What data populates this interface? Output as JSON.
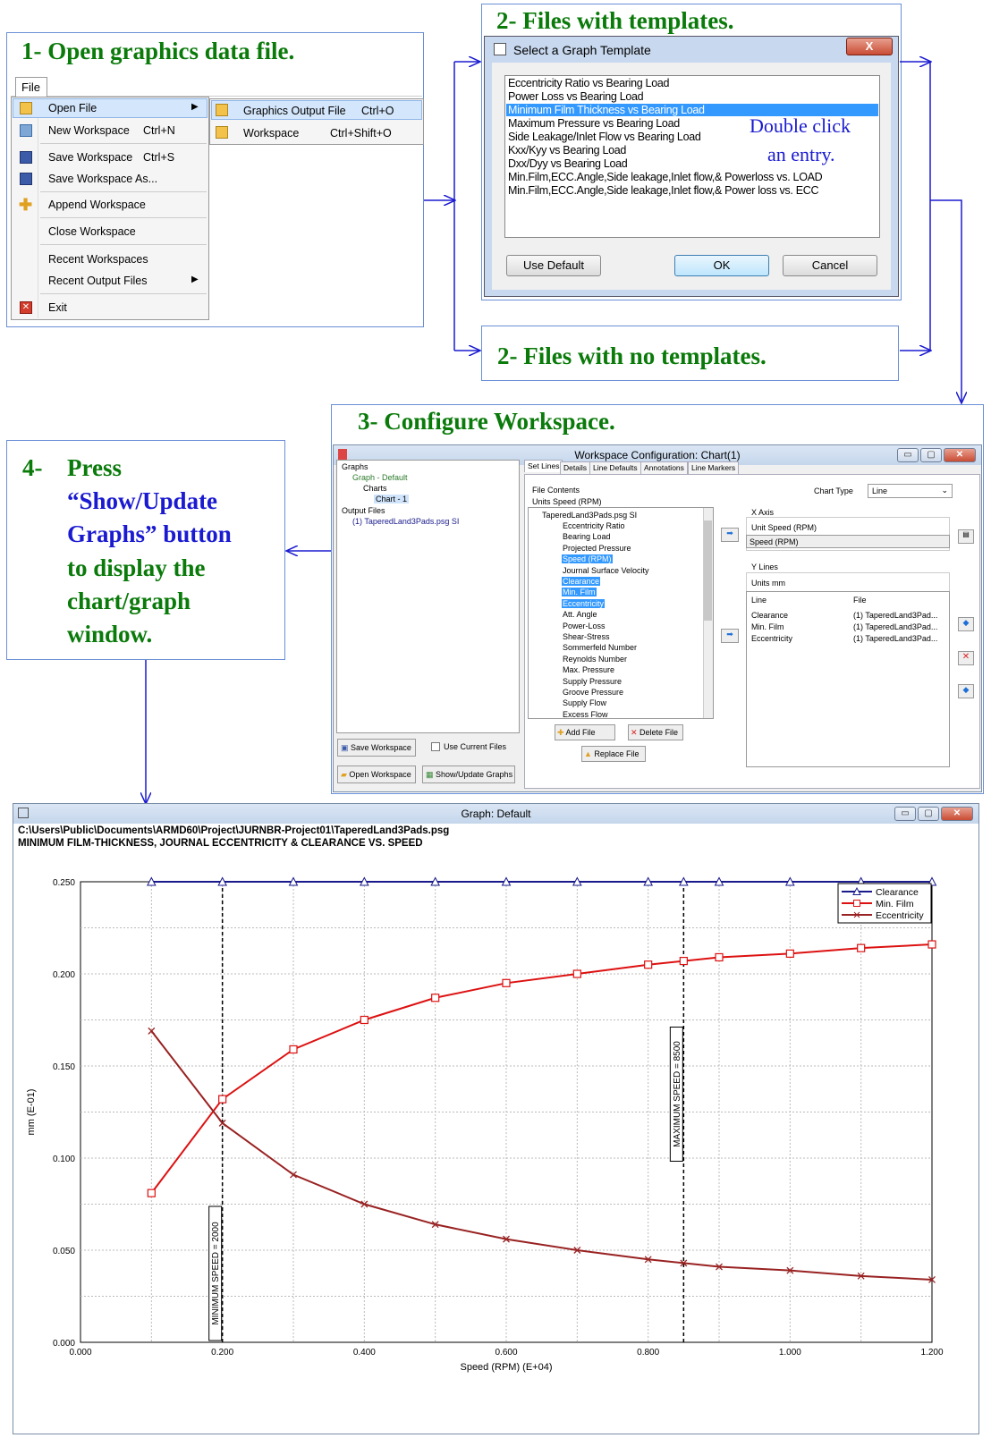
{
  "step1": {
    "title": "1-  Open graphics data file.",
    "menu_bar": "File",
    "items": [
      "Open File",
      "New Workspace",
      "Save Workspace",
      "Save Workspace As...",
      "Append Workspace",
      "Close Workspace",
      "Recent Workspaces",
      "Recent Output Files",
      "Exit"
    ],
    "shortcuts": {
      "new": "Ctrl+N",
      "save": "Ctrl+S"
    },
    "submenu": [
      {
        "label": "Graphics Output File",
        "shortcut": "Ctrl+O"
      },
      {
        "label": "Workspace",
        "shortcut": "Ctrl+Shift+O"
      }
    ]
  },
  "step2a": {
    "title": "2-  Files with templates.",
    "dialog_title": "Select a Graph Template",
    "templates": [
      "Eccentricity Ratio vs Bearing Load",
      "Power Loss vs Bearing Load",
      "Minimum Film Thickness vs Bearing Load",
      "Maximum Pressure vs Bearing Load",
      "Side Leakage/Inlet Flow vs Bearing Load",
      "Kxx/Kyy vs Bearing Load",
      "Dxx/Dyy vs Bearing Load",
      "Min.Film,ECC.Angle,Side leakage,Inlet flow,& Powerloss vs. LOAD",
      "Min.Film,ECC.Angle,Side leakage,Inlet flow,& Power loss vs. ECC"
    ],
    "hint_line1": "Double click",
    "hint_line2": "an  entry.",
    "btn_default": "Use Default",
    "btn_ok": "OK",
    "btn_cancel": "Cancel"
  },
  "step2b": {
    "title": "2-  Files with no templates."
  },
  "step3": {
    "title": "3-  Configure Workspace.",
    "window_title": "Workspace Configuration: Chart(1)",
    "tree": [
      "Graphs",
      "Graph - Default",
      "Charts",
      "Chart - 1",
      "Output Files",
      "(1) TaperedLand3Pads.psg SI"
    ],
    "tabs": [
      "Set Lines",
      "Details",
      "Line Defaults",
      "Annotations",
      "Line Markers"
    ],
    "file_contents_label": "File Contents",
    "units_label": "Units   Speed (RPM)",
    "file_root": "TaperedLand3Pads.psg SI",
    "file_items": [
      "Eccentricity Ratio",
      "Bearing Load",
      "Projected Pressure",
      "Speed (RPM)",
      "Journal Surface Velocity",
      "Clearance",
      "Min. Film",
      "Eccentricity",
      "Att. Angle",
      "Power-Loss",
      "Shear-Stress",
      "Sommerfeld Number",
      "Reynolds Number",
      "Max. Pressure",
      "Supply Pressure",
      "Groove Pressure",
      "Supply Flow",
      "Excess Flow"
    ],
    "chart_type_label": "Chart Type",
    "chart_type_value": "Line",
    "x_axis_label": "X Axis",
    "x_unit": "Unit   Speed (RPM)",
    "x_value": "Speed (RPM)",
    "y_lines_label": "Y Lines",
    "y_units": "Units  mm",
    "y_headers": [
      "Line",
      "File"
    ],
    "y_rows": [
      [
        "Clearance",
        "(1) TaperedLand3Pad..."
      ],
      [
        "Min. Film",
        "(1) TaperedLand3Pad..."
      ],
      [
        "Eccentricity",
        "(1) TaperedLand3Pad..."
      ]
    ],
    "btn_add_file": "Add File",
    "btn_delete_file": "Delete File",
    "btn_replace_file": "Replace File",
    "btn_save_ws": "Save Workspace",
    "chk_use_current": "Use Current Files",
    "btn_open_ws": "Open Workspace",
    "btn_show_update": "Show/Update Graphs"
  },
  "step4": {
    "num": "4-",
    "line1": "Press",
    "line2": "“Show/Update",
    "line3": "Graphs” button",
    "line4": "to display the",
    "line5": "chart/graph",
    "line6": "window."
  },
  "graph_window": {
    "title": "Graph: Default",
    "path": "C:\\Users\\Public\\Documents\\ARMD60\\Project\\JURNBR-Project01\\TaperedLand3Pads.psg",
    "heading": "MINIMUM FILM-THICKNESS, JOURNAL ECCENTRICITY & CLEARANCE VS. SPEED"
  },
  "chart_data": {
    "type": "line",
    "xlabel": "Speed (RPM) (E+04)",
    "ylabel": "mm (E-01)",
    "xlim": [
      0.0,
      1.2
    ],
    "ylim": [
      0.0,
      0.25
    ],
    "xticks": [
      "0.000",
      "0.200",
      "0.400",
      "0.600",
      "0.800",
      "1.000",
      "1.200"
    ],
    "yticks": [
      "0.000",
      "0.050",
      "0.100",
      "0.150",
      "0.200",
      "0.250"
    ],
    "x": [
      0.1,
      0.2,
      0.3,
      0.4,
      0.5,
      0.6,
      0.7,
      0.8,
      0.85,
      0.9,
      1.0,
      1.1,
      1.2
    ],
    "series": [
      {
        "name": "Clearance",
        "color": "#1a1a8c",
        "marker": "triangle",
        "values": [
          0.25,
          0.25,
          0.25,
          0.25,
          0.25,
          0.25,
          0.25,
          0.25,
          0.25,
          0.25,
          0.25,
          0.25,
          0.25
        ]
      },
      {
        "name": "Min. Film",
        "color": "#dd1111",
        "marker": "square",
        "values": [
          0.081,
          0.132,
          0.159,
          0.175,
          0.187,
          0.195,
          0.2,
          0.205,
          0.207,
          0.209,
          0.211,
          0.214,
          0.216
        ]
      },
      {
        "name": "Eccentricity",
        "color": "#992222",
        "marker": "x",
        "values": [
          0.169,
          0.119,
          0.091,
          0.075,
          0.064,
          0.056,
          0.05,
          0.045,
          0.043,
          0.041,
          0.039,
          0.036,
          0.034
        ]
      }
    ],
    "vlines": [
      {
        "x": 0.2,
        "label": "MINIMUM SPEED = 2000"
      },
      {
        "x": 0.85,
        "label": "MAXIMUM SPEED = 8500"
      }
    ],
    "legend": "top-right",
    "grid": true
  }
}
